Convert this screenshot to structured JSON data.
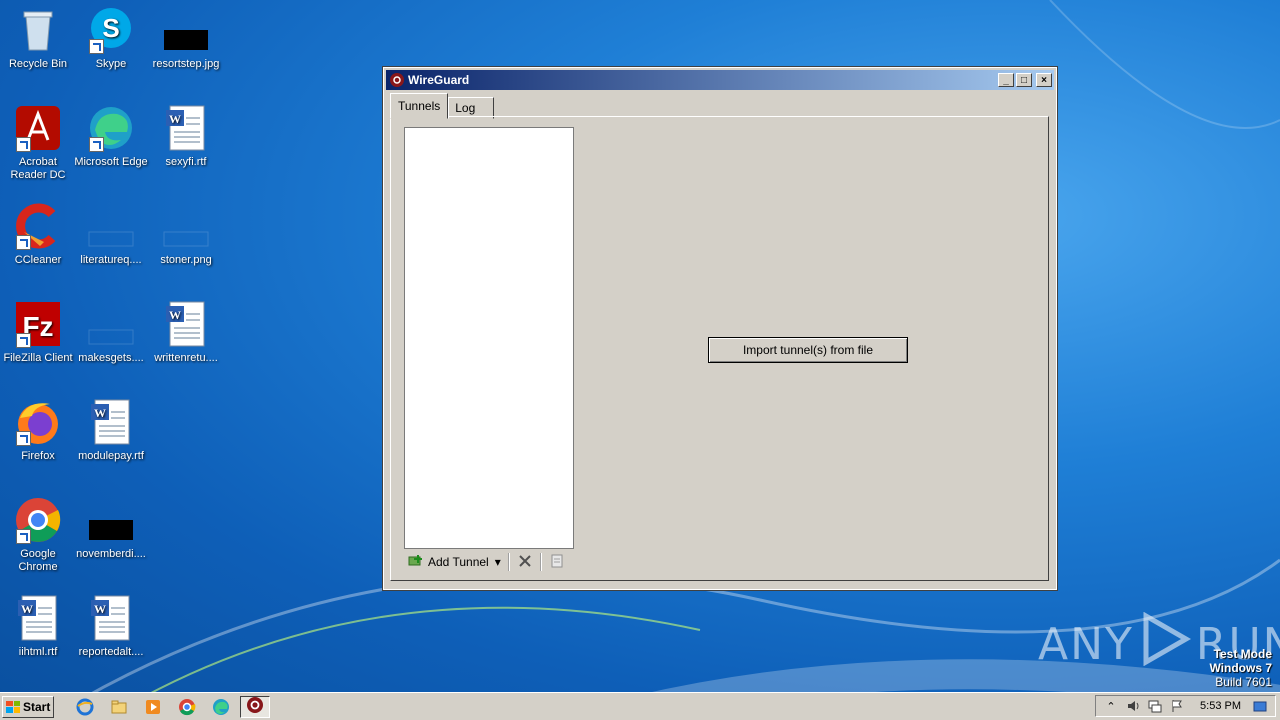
{
  "desktop": {
    "icons": [
      {
        "label": "Recycle Bin",
        "icon": "recycle-bin-icon"
      },
      {
        "label": "Skype",
        "icon": "skype-icon"
      },
      {
        "label": "resortstep.jpg",
        "icon": "image-file-icon"
      },
      {
        "label": "Acrobat Reader DC",
        "icon": "acrobat-icon"
      },
      {
        "label": "Microsoft Edge",
        "icon": "edge-icon"
      },
      {
        "label": "sexyfi.rtf",
        "icon": "word-doc-icon"
      },
      {
        "label": "CCleaner",
        "icon": "ccleaner-icon"
      },
      {
        "label": "literatureq....",
        "icon": "blank-file-icon"
      },
      {
        "label": "stoner.png",
        "icon": "blank-file-icon"
      },
      {
        "label": "FileZilla Client",
        "icon": "filezilla-icon"
      },
      {
        "label": "makesgets....",
        "icon": "blank-file-icon"
      },
      {
        "label": "writtenretu....",
        "icon": "word-doc-icon"
      },
      {
        "label": "Firefox",
        "icon": "firefox-icon"
      },
      {
        "label": "modulepay.rtf",
        "icon": "word-doc-icon"
      },
      {
        "label": "Google Chrome",
        "icon": "chrome-icon"
      },
      {
        "label": "novemberdi....",
        "icon": "image-file-icon"
      },
      {
        "label": "iihtml.rtf",
        "icon": "word-doc-icon"
      },
      {
        "label": "reportedalt....",
        "icon": "word-doc-icon"
      }
    ]
  },
  "window": {
    "title": "WireGuard",
    "controls": {
      "minimize": "_",
      "maximize": "□",
      "close": "×"
    },
    "tabs": [
      {
        "label": "Tunnels",
        "active": true
      },
      {
        "label": "Log",
        "active": false
      }
    ],
    "toolbar": {
      "add_tunnel_label": "Add Tunnel",
      "dropdown_glyph": "▾"
    },
    "import_button_label": "Import tunnel(s) from file"
  },
  "taskbar": {
    "start_label": "Start",
    "clock": "5:53 PM"
  },
  "watermark": {
    "line1": "Test Mode",
    "line2": "Windows 7",
    "line3": "Build 7601",
    "brand_left": "ANY",
    "brand_right": "RUN"
  },
  "colors": {
    "titlebar_start": "#0a246a",
    "titlebar_end": "#a6caf0",
    "window_face": "#d4d0c8",
    "desktop_blue": "#1f7fd6"
  }
}
